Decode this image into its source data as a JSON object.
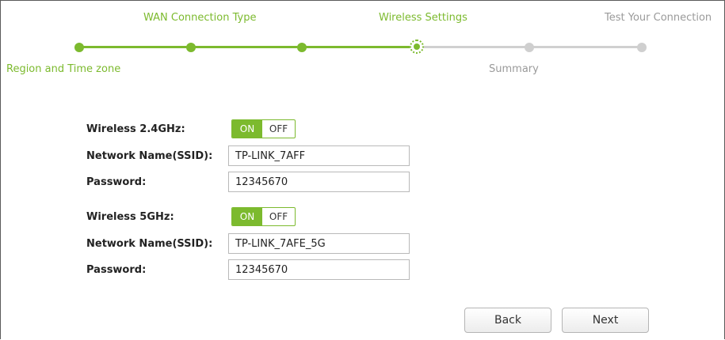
{
  "wizard": {
    "steps_top": [
      {
        "label": "WAN Connection Type",
        "state": "done"
      },
      {
        "label": "Wireless Settings",
        "state": "done"
      },
      {
        "label": "Test Your Connection",
        "state": "todo"
      }
    ],
    "steps_bottom": [
      {
        "label": "Region and Time zone",
        "state": "done"
      },
      {
        "label": "Summary",
        "state": "todo"
      }
    ],
    "current_step": "Wireless Settings"
  },
  "wireless_24": {
    "label": "Wireless 2.4GHz:",
    "toggle_on": "ON",
    "toggle_off": "OFF",
    "enabled": true,
    "ssid_label": "Network Name(SSID):",
    "ssid_value": "TP-LINK_7AFF",
    "password_label": "Password:",
    "password_value": "12345670"
  },
  "wireless_5": {
    "label": "Wireless 5GHz:",
    "toggle_on": "ON",
    "toggle_off": "OFF",
    "enabled": true,
    "ssid_label": "Network Name(SSID):",
    "ssid_value": "TP-LINK_7AFE_5G",
    "password_label": "Password:",
    "password_value": "12345670"
  },
  "buttons": {
    "back": "Back",
    "next": "Next"
  },
  "colors": {
    "accent": "#7cba2e",
    "inactive": "#cfcfcf"
  }
}
